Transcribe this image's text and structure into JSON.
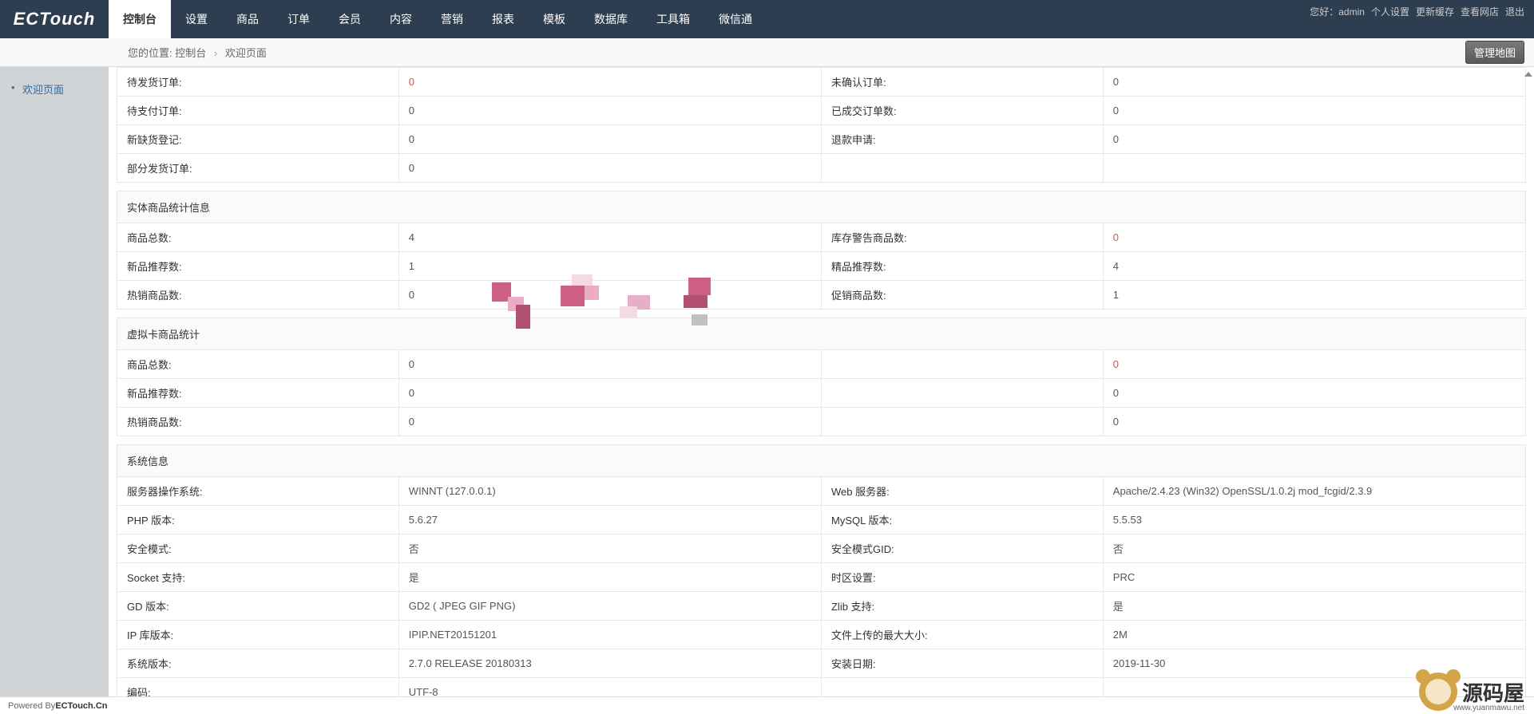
{
  "header": {
    "logo_text": "ECTouch",
    "greeting": "您好：admin",
    "links": [
      "个人设置",
      "更新缓存",
      "查看网店",
      "退出"
    ]
  },
  "nav": [
    "控制台",
    "设置",
    "商品",
    "订单",
    "会员",
    "内容",
    "营销",
    "报表",
    "模板",
    "数据库",
    "工具箱",
    "微信通"
  ],
  "breadcrumb": {
    "label": "您的位置:",
    "items": [
      "控制台",
      "欢迎页面"
    ]
  },
  "map_button": "管理地图",
  "sidebar": {
    "items": [
      "欢迎页面"
    ]
  },
  "order_stats": {
    "rows": [
      {
        "l1": "待发货订单:",
        "v1": "0",
        "red1": true,
        "l2": "未确认订单:",
        "v2": "0"
      },
      {
        "l1": "待支付订单:",
        "v1": "0",
        "l2": "已成交订单数:",
        "v2": "0"
      },
      {
        "l1": "新缺货登记:",
        "v1": "0",
        "l2": "退款申请:",
        "v2": "0"
      },
      {
        "l1": "部分发货订单:",
        "v1": "0",
        "l2": "",
        "v2": ""
      }
    ]
  },
  "entity_stats": {
    "title": "实体商品统计信息",
    "rows": [
      {
        "l1": "商品总数:",
        "v1": "4",
        "l2": "库存警告商品数:",
        "v2": "0",
        "red2": true
      },
      {
        "l1": "新品推荐数:",
        "v1": "1",
        "green_label1": true,
        "l2": "精品推荐数:",
        "v2": "4",
        "green_label2": true
      },
      {
        "l1": "热销商品数:",
        "v1": "0",
        "green_label1": true,
        "l2": "促销商品数:",
        "v2": "1",
        "green_label2": true
      }
    ]
  },
  "virtual_stats": {
    "title": "虚拟卡商品统计",
    "rows": [
      {
        "l1": "商品总数:",
        "v1": "0",
        "l2": "",
        "v2": "0",
        "red2": true
      },
      {
        "l1": "新品推荐数:",
        "v1": "0",
        "green_label1": true,
        "l2": "",
        "v2": "0"
      },
      {
        "l1": "热销商品数:",
        "v1": "0",
        "green_label1": true,
        "l2": "",
        "v2": "0"
      }
    ]
  },
  "sys_info": {
    "title": "系统信息",
    "rows": [
      {
        "l1": "服务器操作系统:",
        "v1": "WINNT (127.0.0.1)",
        "l2": "Web 服务器:",
        "v2": "Apache/2.4.23 (Win32) OpenSSL/1.0.2j mod_fcgid/2.3.9"
      },
      {
        "l1": "PHP 版本:",
        "v1": "5.6.27",
        "l2": "MySQL 版本:",
        "v2": "5.5.53"
      },
      {
        "l1": "安全模式:",
        "v1": "否",
        "l2": "安全模式GID:",
        "v2": "否"
      },
      {
        "l1": "Socket 支持:",
        "v1": "是",
        "l2": "时区设置:",
        "v2": "PRC"
      },
      {
        "l1": "GD 版本:",
        "v1": "GD2 ( JPEG GIF PNG)",
        "l2": "Zlib 支持:",
        "v2": "是"
      },
      {
        "l1": "IP 库版本:",
        "v1": "IPIP.NET20151201",
        "l2": "文件上传的最大大小:",
        "v2": "2M"
      },
      {
        "l1": "系统版本:",
        "v1": "2.7.0 RELEASE 20180313",
        "l2": "安装日期:",
        "v2": "2019-11-30"
      },
      {
        "l1": "编码:",
        "v1": "UTF-8",
        "l2": "",
        "v2": ""
      }
    ]
  },
  "footer": {
    "prefix": "Powered By ",
    "link": "ECTouch.Cn"
  },
  "watermark": {
    "brand": "源码屋",
    "url": "www.yuanmawu.net"
  }
}
